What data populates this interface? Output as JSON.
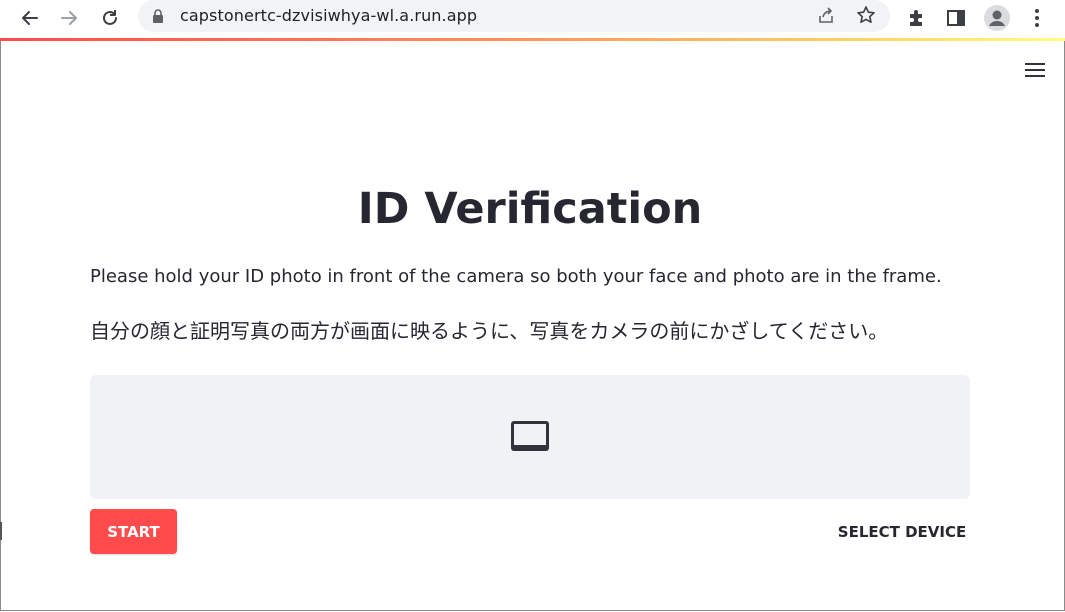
{
  "browser": {
    "url": "capstonertc-dzvisiwhya-wl.a.run.app",
    "icons": {
      "back": "back-arrow-icon",
      "forward": "forward-arrow-icon",
      "reload": "reload-icon",
      "lock": "lock-icon",
      "share": "share-icon",
      "bookmark": "star-icon",
      "extensions": "puzzle-icon",
      "side_panel": "side-panel-icon",
      "profile": "profile-icon",
      "menu": "kebab-menu-icon"
    }
  },
  "app": {
    "menu_icon": "hamburger-menu-icon",
    "title": "ID Verification",
    "instruction_en": "Please hold your ID photo in front of the camera so both your face and photo are in the frame.",
    "instruction_ja": "自分の顔と証明写真の両方が画面に映るように、写真をカメラの前にかざしてください。",
    "video_placeholder_icon": "video-placeholder-icon",
    "start_label": "START",
    "select_device_label": "SELECT DEVICE"
  },
  "colors": {
    "accent": "#ff4b4b",
    "text": "#262730",
    "video_bg": "#f0f2f6",
    "omnibox_bg": "#f1f3f4"
  }
}
